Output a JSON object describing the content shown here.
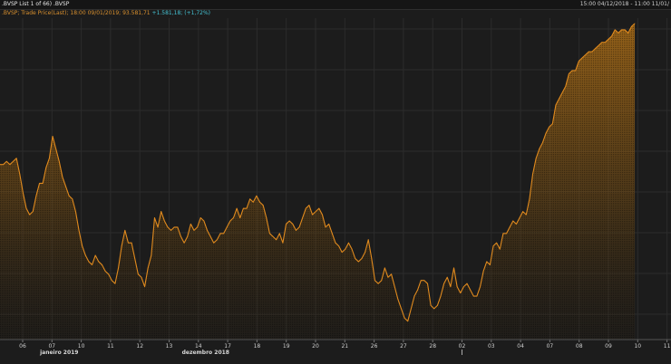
{
  "header": {
    "title": ".BVSP List 1 of 66) .BVSP",
    "range": "15:00 04/12/2018 - 11:00 11/01/"
  },
  "legend": {
    "series": ".BVSP; Trade Price(Last); 18:00 09/01/2019; 93.581,71",
    "change": "+1.581,18; (+1,72%)"
  },
  "colors": {
    "line": "#e08a1e",
    "grid": "#2c2c2c",
    "background": "#1c1c1c",
    "change": "#45c3d4"
  },
  "chart_data": {
    "type": "area",
    "x_tick_labels": [
      "06",
      "07",
      "10",
      "11",
      "12",
      "13",
      "14",
      "17",
      "18",
      "19",
      "20",
      "21",
      "26",
      "27",
      "28",
      "02",
      "03",
      "04",
      "07",
      "08",
      "09",
      "10",
      "11"
    ],
    "month_labels": [
      {
        "text": "dezembro 2018",
        "under_tick": "14"
      },
      {
        "text": "janeiro 2019",
        "under_tick": "07"
      }
    ],
    "ylim": [
      0,
      100
    ],
    "values": [
      55,
      55,
      56,
      55,
      56,
      57,
      52,
      46,
      41,
      39,
      40,
      45,
      49,
      49,
      54,
      57,
      64,
      60,
      56,
      51,
      48,
      45,
      44,
      40,
      34,
      29,
      26,
      24,
      23,
      26,
      24,
      23,
      21,
      20,
      18,
      17,
      22,
      29,
      34,
      30,
      30,
      25,
      20,
      19,
      16,
      22,
      26,
      38,
      35,
      40,
      37,
      35,
      34,
      35,
      35,
      32,
      30,
      32,
      36,
      34,
      35,
      38,
      37,
      34,
      32,
      30,
      31,
      33,
      33,
      35,
      37,
      38,
      41,
      38,
      41,
      41,
      44,
      43,
      45,
      43,
      42,
      38,
      33,
      32,
      31,
      33,
      30,
      36,
      37,
      36,
      34,
      35,
      38,
      41,
      42,
      39,
      40,
      41,
      39,
      35,
      36,
      33,
      30,
      29,
      27,
      28,
      30,
      28,
      25,
      24,
      25,
      27,
      31,
      25,
      18,
      17,
      18,
      22,
      19,
      20,
      16,
      12,
      9,
      6,
      5,
      9,
      13,
      15,
      18,
      18,
      17,
      10,
      9,
      10,
      13,
      17,
      19,
      16,
      22,
      16,
      14,
      16,
      17,
      15,
      13,
      13,
      16,
      21,
      24,
      23,
      29,
      30,
      28,
      33,
      33,
      35,
      37,
      36,
      38,
      40,
      39,
      44,
      52,
      57,
      60,
      62,
      65,
      67,
      68,
      74,
      76,
      78,
      80,
      84,
      85,
      85,
      88,
      89,
      90,
      91,
      91,
      92,
      93,
      94,
      94,
      95,
      96,
      98,
      97,
      98,
      98,
      97,
      99,
      100
    ]
  }
}
